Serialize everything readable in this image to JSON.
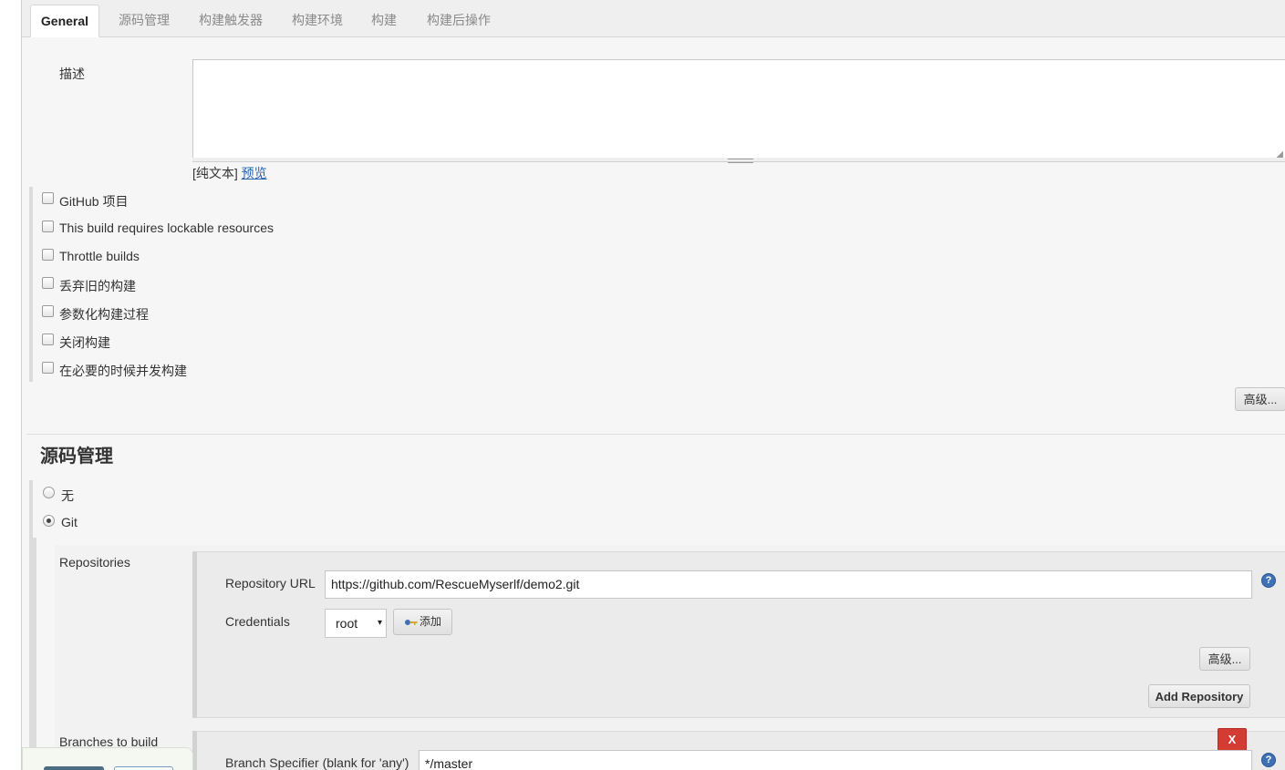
{
  "tabs": [
    {
      "label": "General",
      "active": true
    },
    {
      "label": "源码管理",
      "active": false
    },
    {
      "label": "构建触发器",
      "active": false
    },
    {
      "label": "构建环境",
      "active": false
    },
    {
      "label": "构建",
      "active": false
    },
    {
      "label": "构建后操作",
      "active": false
    }
  ],
  "general": {
    "description_label": "描述",
    "description_value": "",
    "format_prefix": "[纯文本]",
    "preview_link": "预览",
    "options": [
      {
        "label": "GitHub 项目",
        "checked": false
      },
      {
        "label": "This build requires lockable resources",
        "checked": false
      },
      {
        "label": "Throttle builds",
        "checked": false
      },
      {
        "label": "丢弃旧的构建",
        "checked": false
      },
      {
        "label": "参数化构建过程",
        "checked": false
      },
      {
        "label": "关闭构建",
        "checked": false
      },
      {
        "label": "在必要的时候并发构建",
        "checked": false
      }
    ],
    "advanced_button": "高级..."
  },
  "scm": {
    "title": "源码管理",
    "choices": [
      {
        "label": "无",
        "selected": false
      },
      {
        "label": "Git",
        "selected": true
      }
    ],
    "repositories_label": "Repositories",
    "repo_url_label": "Repository URL",
    "repo_url_value": "https://github.com/RescueMyserlf/demo2.git",
    "credentials_label": "Credentials",
    "credentials_value": "root",
    "add_button": "添加",
    "advanced_button": "高级...",
    "add_repository_button": "Add Repository",
    "branches_label": "Branches to build",
    "branch_specifier_label": "Branch Specifier (blank for 'any')",
    "branch_specifier_value": "*/master",
    "delete_button": "X"
  },
  "icons": {
    "help": "?",
    "key": "key-icon",
    "dropdown": "▾"
  },
  "colors": {
    "link": "#2a64b5",
    "delete": "#d43b33",
    "help": "#3f6fb5",
    "save_button": "#4c6c82"
  }
}
